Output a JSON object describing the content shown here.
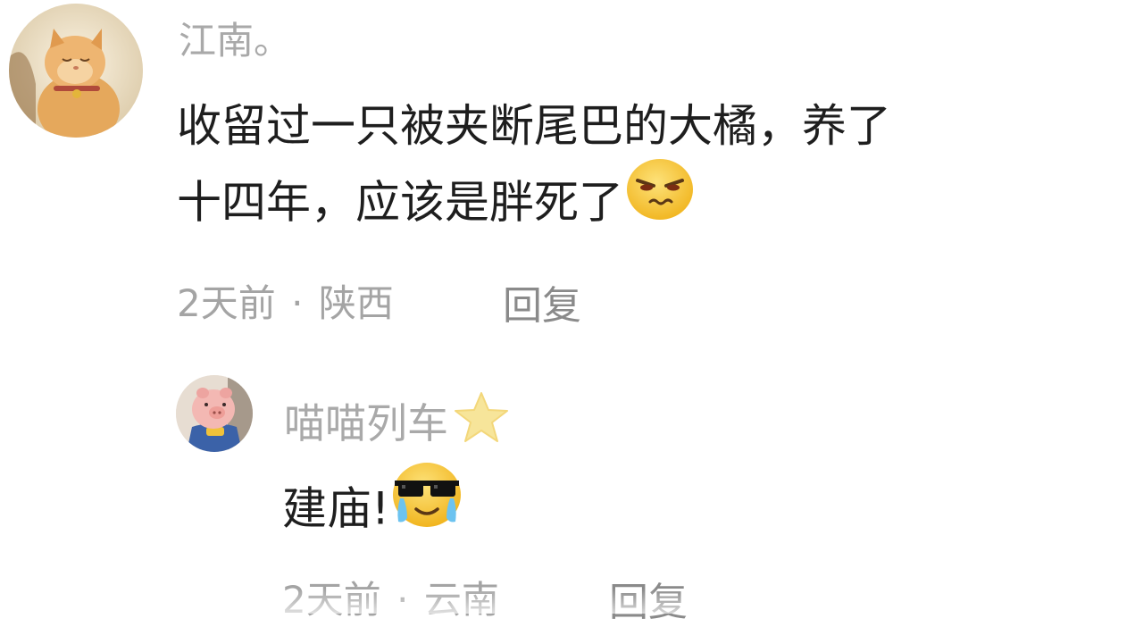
{
  "comments": [
    {
      "username": "江南。",
      "text_line1": "收留过一只被夹断尾巴的大橘，养了",
      "text_line2": "十四年，应该是胖死了",
      "trailing_emoji": "smirk-face-emoji",
      "time": "2天前",
      "separator": "·",
      "location": "陕西",
      "reply_label": "回复",
      "avatar": "orange-cat-avatar"
    },
    {
      "username": "喵喵列车",
      "username_badge": "star-icon",
      "text": "建庙!",
      "trailing_emoji": "sunglasses-crying-emoji",
      "time": "2天前",
      "separator": "·",
      "location": "云南",
      "reply_label": "回复",
      "avatar": "pink-pig-plush-avatar"
    }
  ],
  "colors": {
    "username": "#a9a9a9",
    "body_text": "#1e1e1e",
    "meta": "#a4a4a4",
    "reply": "#8a8a8a",
    "emoji_yellow": "#f7c431",
    "star": "#f6e18a"
  }
}
